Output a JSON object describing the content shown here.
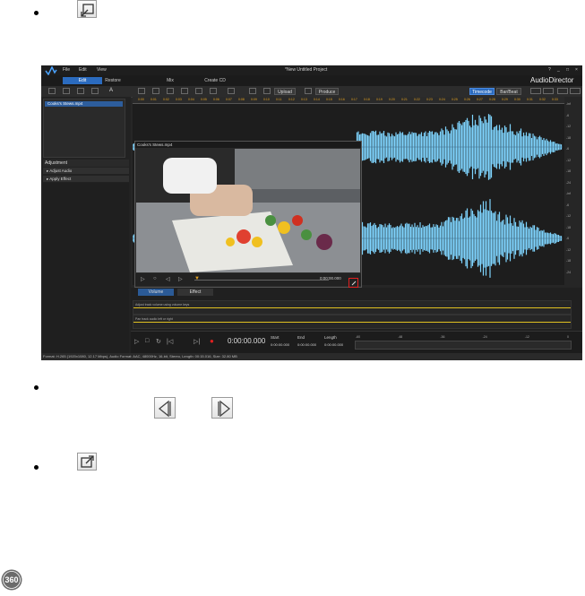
{
  "app": {
    "menu": [
      "File",
      "Edit",
      "View"
    ],
    "window_title": "*New Untitled Project",
    "window_controls": [
      "?",
      "_",
      "□",
      "×"
    ],
    "tabs": [
      "Edit",
      "Restore",
      "Mix",
      "Create CD"
    ],
    "active_tab": "Edit",
    "brand": "AudioDirector",
    "toolbar": {
      "upload_label": "Upload",
      "produce_label": "Produce",
      "timecode_label": "Timecode",
      "barbeat_label": "Bar/Beat"
    },
    "media_file": "Cooks's Stews.mp4",
    "preview_title": "Cooks's Stews.mp4",
    "preview_time": "0:00:00.000",
    "adjustment": {
      "title": "Adjustment",
      "items": [
        "Adjust Audio",
        "Apply Effect"
      ]
    },
    "volume_tabs": [
      "Volume",
      "Effect"
    ],
    "envelope_labels": [
      "Adjust track volume using volume keys",
      "Pan track audio left or right"
    ],
    "transport": {
      "timecode": "0:00:00.000",
      "start_label": "Start",
      "end_label": "End",
      "length_label": "Length",
      "start_value": "0:00:00.000",
      "end_value": "0:00:00.000",
      "length_value": "0:00:00.000",
      "meter_ticks": [
        "-60",
        "-48",
        "-36",
        "-24",
        "-12",
        "0"
      ]
    },
    "status": "Format: H.265 (1920x1080, 12.17 Mbps), Audio Format: AAC, 48000Hz, 16-bit, Stereo, Length: 00:15.016, Size: 32.80 MB",
    "ruler_ticks": [
      "0:00",
      "0:01",
      "0:02",
      "0:03",
      "0:04",
      "0:05",
      "0:06",
      "0:07",
      "0:08",
      "0:09",
      "0:10",
      "0:11",
      "0:12",
      "0:13",
      "0:14",
      "0:15",
      "0:16",
      "0:17",
      "0:18",
      "0:19",
      "0:20",
      "0:21",
      "0:22",
      "0:23",
      "0:24",
      "0:25",
      "0:26",
      "0:27",
      "0:28",
      "0:29",
      "0:30",
      "0:31",
      "0:32",
      "0:33"
    ],
    "scale_ticks": [
      "-inf",
      "-6",
      "-12",
      "-18",
      "-6",
      "-12",
      "-18",
      "-24",
      "-inf",
      "-6",
      "-12",
      "-18",
      "-6",
      "-12",
      "-18",
      "-24"
    ]
  },
  "colors": {
    "accent": "#2b6bbf",
    "waveform": "#7fd4ff",
    "timeline": "#e0a020",
    "highlight": "#e02020"
  },
  "badge_360": "360"
}
